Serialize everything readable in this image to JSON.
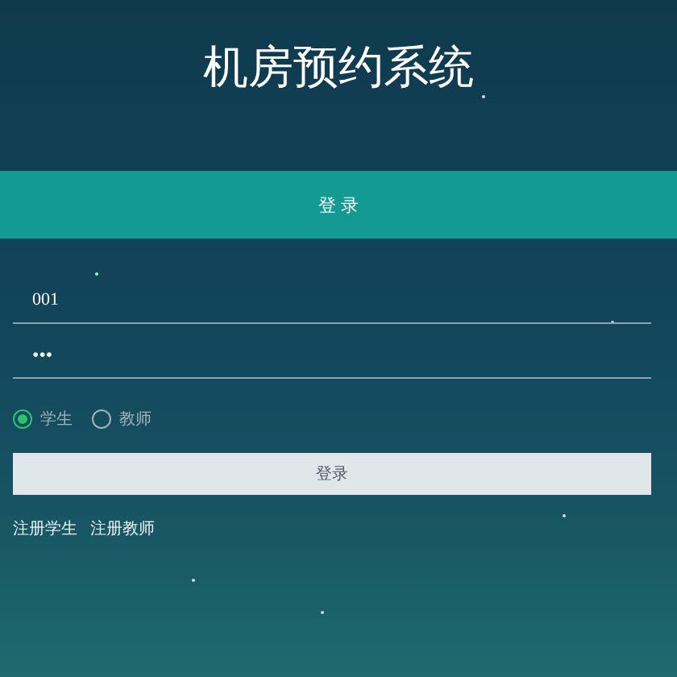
{
  "title": "机房预约系统",
  "header": {
    "label": "登 录"
  },
  "username": {
    "value": "001"
  },
  "password": {
    "value": "•••"
  },
  "roles": [
    {
      "label": "学生",
      "selected": true
    },
    {
      "label": "教师",
      "selected": false
    }
  ],
  "submit": {
    "label": "登录"
  },
  "links": [
    "注册学生",
    "注册教师"
  ]
}
